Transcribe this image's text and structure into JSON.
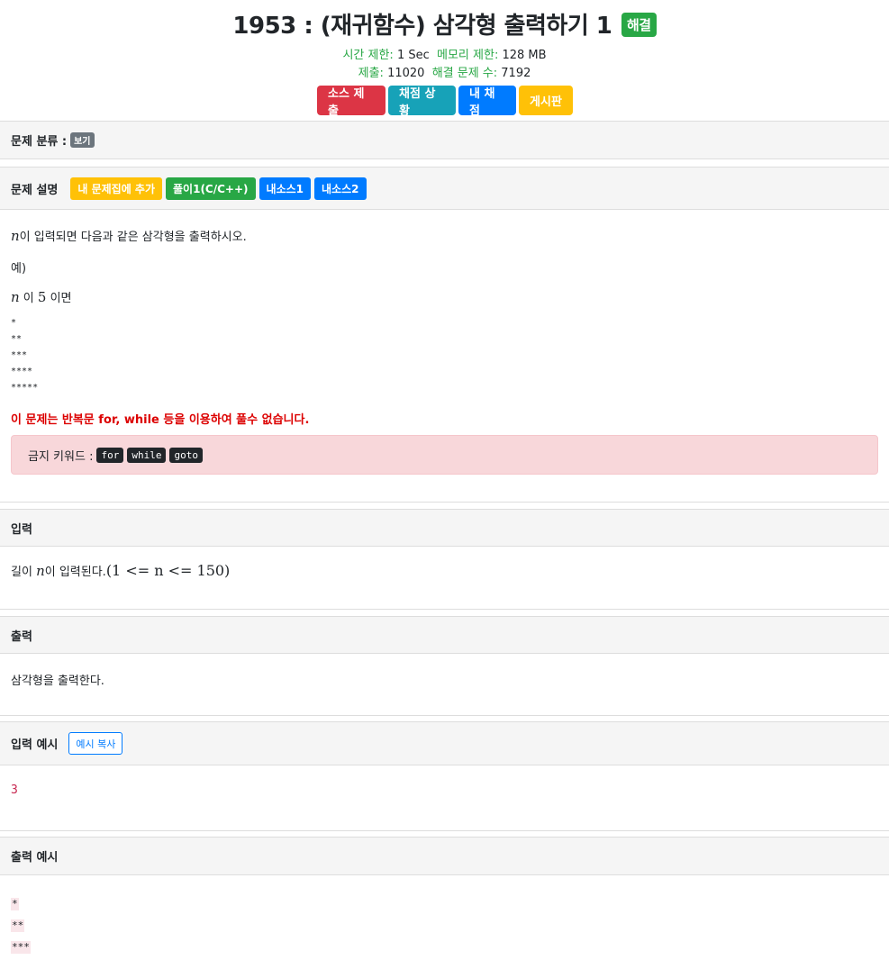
{
  "problem": {
    "title": "1953 : (재귀함수) 삼각형 출력하기 1",
    "solved_badge": "해결",
    "time_limit_label": "시간 제한:",
    "time_limit": "1 Sec",
    "memory_limit_label": "메모리 제한:",
    "memory_limit": "128 MB",
    "submit_label": "제출:",
    "submit_count": "11020",
    "solved_label": "해결 문제 수:",
    "solved_count": "7192"
  },
  "buttons": {
    "submit": "소스 제출",
    "status": "채점 상황",
    "my_status": "내 채점",
    "board": "게시판"
  },
  "category": {
    "label": "문제 분류 :",
    "show": "보기"
  },
  "description": {
    "heading": "문제 설명",
    "add_to_set": "내 문제집에 추가",
    "solution": "풀이1(C/C++)",
    "my_source1": "내소스1",
    "my_source2": "내소스2",
    "line1_var": "n",
    "line1_text": "이 입력되면 다음과 같은 삼각형을 출력하시오.",
    "line2": "예)",
    "line3_var": "n",
    "line3_mid": " 이 ",
    "line3_num": "5",
    "line3_end": " 이면",
    "stars": [
      "*",
      "**",
      "***",
      "****",
      "*****"
    ],
    "warning": "이 문제는 반복문 for, while 등을 이용하여 풀수 없습니다.",
    "forbidden_label": "금지 키워드 :",
    "forbidden_keywords": [
      "for",
      "while",
      "goto"
    ]
  },
  "input": {
    "heading": "입력",
    "text_pre": "길이 ",
    "text_var": "n",
    "text_post": "이 입력된다.",
    "text_math": "(1 <= n <= 150)"
  },
  "output": {
    "heading": "출력",
    "text": "삼각형을 출력한다."
  },
  "sample_input": {
    "heading": "입력 예시",
    "copy_button": "예시 복사",
    "value": "3"
  },
  "sample_output": {
    "heading": "출력 예시",
    "lines": [
      "*",
      "**",
      "***"
    ]
  }
}
